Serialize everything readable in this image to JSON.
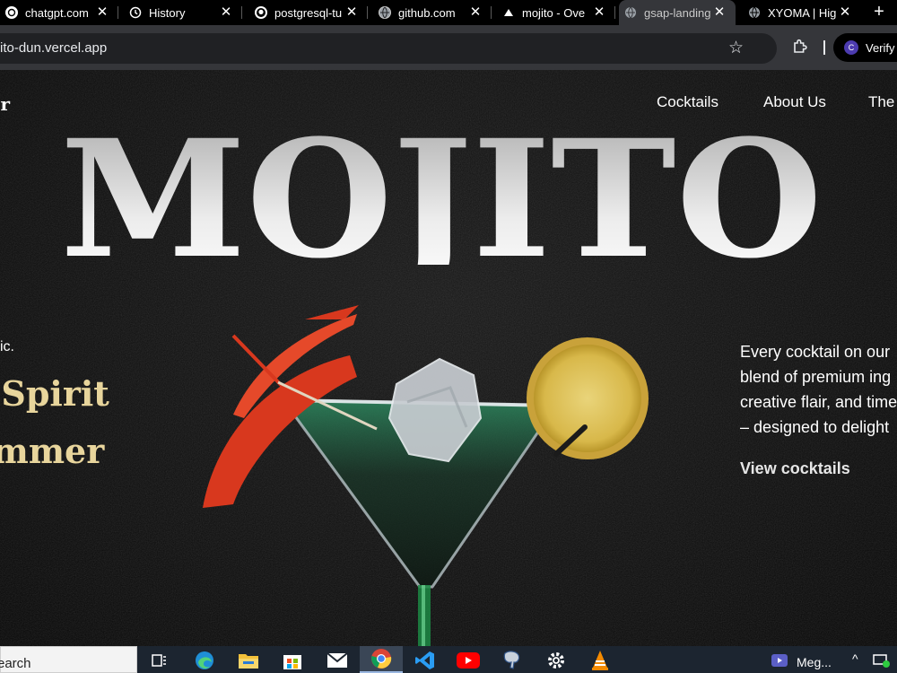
{
  "browser": {
    "tabs": [
      {
        "title": "chatgpt.com",
        "icon": "chatgpt-icon"
      },
      {
        "title": "History",
        "icon": "history-icon"
      },
      {
        "title": "postgresql-tu",
        "icon": "github-icon"
      },
      {
        "title": "github.com",
        "icon": "globe-icon"
      },
      {
        "title": "mojito - Ove",
        "icon": "vercel-icon"
      },
      {
        "title": "gsap-landing",
        "icon": "globe-icon",
        "active": true
      },
      {
        "title": "XYOMA | Hig",
        "icon": "globe-icon"
      }
    ],
    "close_glyph": "✕",
    "new_tab_glyph": "+",
    "address": "ito-dun.vercel.app",
    "bookmark_glyph": "☆",
    "profile_initial": "C",
    "profile_label": "Verify it"
  },
  "page": {
    "logo": "ur",
    "nav": [
      "Cocktails",
      "About Us",
      "The"
    ],
    "hero_title": "MOJITO",
    "tagline": "sic.",
    "headline_1": "e Spirit",
    "headline_2": "ummer",
    "description_lines": [
      "Every cocktail on our",
      "blend of premium ing",
      "creative flair, and time",
      "– designed to delight"
    ],
    "cta": "View cocktails",
    "colors": {
      "background": "#0b0b0b",
      "headline": "#e8d59c",
      "hero_gradient_top": "#a6a6a6",
      "hero_gradient_bottom": "#ffffff"
    }
  },
  "taskbar": {
    "search_label": "earch",
    "apps": [
      "task-view-icon",
      "edge-icon",
      "file-explorer-icon",
      "store-icon",
      "mail-icon",
      "chrome-icon",
      "vscode-icon",
      "youtube-icon",
      "pgadmin-icon",
      "settings-icon",
      "vlc-icon",
      "meet-icon"
    ],
    "meet_label": "Meg...",
    "tray_arrow": "^"
  }
}
